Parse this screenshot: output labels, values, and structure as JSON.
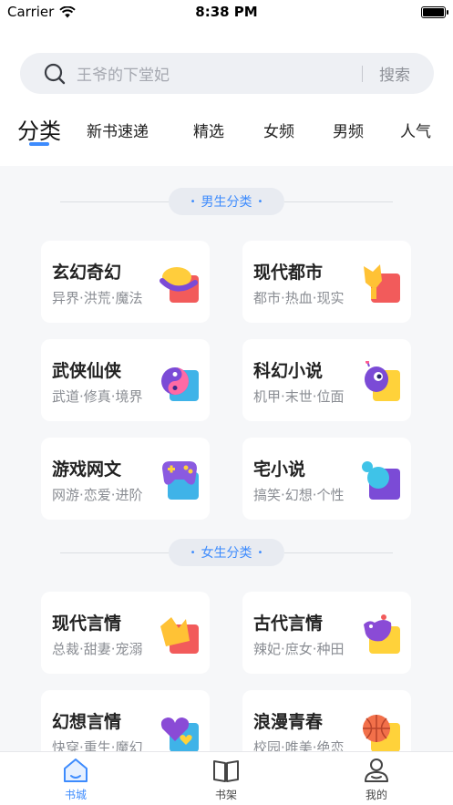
{
  "status_bar": {
    "carrier": "Carrier",
    "time": "8:38 PM"
  },
  "search": {
    "placeholder": "王爷的下堂妃",
    "button_label": "搜索"
  },
  "tabs": [
    {
      "label": "分类"
    },
    {
      "label": "新书速递"
    },
    {
      "label": "精选"
    },
    {
      "label": "女频"
    },
    {
      "label": "男频"
    },
    {
      "label": "人气"
    }
  ],
  "sections": [
    {
      "title": "男生分类",
      "items": [
        {
          "title": "玄幻奇幻",
          "subtitle": "异界·洪荒·魔法",
          "icon": "fantasy-icon"
        },
        {
          "title": "现代都市",
          "subtitle": "都市·热血·现实",
          "icon": "city-icon"
        },
        {
          "title": "武侠仙侠",
          "subtitle": "武道·修真·境界",
          "icon": "yin-yang-icon"
        },
        {
          "title": "科幻小说",
          "subtitle": "机甲·末世·位面",
          "icon": "alien-icon"
        },
        {
          "title": "游戏网文",
          "subtitle": "网游·恋爱·进阶",
          "icon": "gamepad-icon"
        },
        {
          "title": "宅小说",
          "subtitle": "搞笑·幻想·个性",
          "icon": "bubble-icon"
        }
      ]
    },
    {
      "title": "女生分类",
      "items": [
        {
          "title": "现代言情",
          "subtitle": "总裁·甜妻·宠溺",
          "icon": "crown-icon"
        },
        {
          "title": "古代言情",
          "subtitle": "辣妃·庶女·种田",
          "icon": "bird-icon"
        },
        {
          "title": "幻想言情",
          "subtitle": "快穿·重生·魔幻",
          "icon": "heart-icon"
        },
        {
          "title": "浪漫青春",
          "subtitle": "校园·唯美·绝恋",
          "icon": "basketball-icon"
        }
      ]
    }
  ],
  "bottom_nav": [
    {
      "label": "书城",
      "icon": "home-icon"
    },
    {
      "label": "书架",
      "icon": "book-icon"
    },
    {
      "label": "我的",
      "icon": "user-icon"
    }
  ],
  "colors": {
    "accent": "#3d8bfd",
    "background": "#f6f7f9",
    "card": "#ffffff"
  }
}
